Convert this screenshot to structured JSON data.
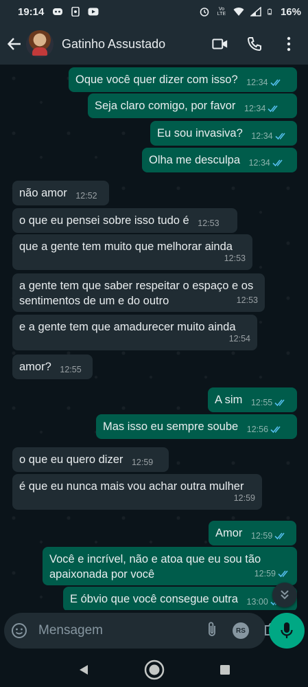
{
  "status": {
    "time": "19:14",
    "battery": "16%",
    "lte": "Vo LTE"
  },
  "header": {
    "contact_name": "Gatinho Assustado"
  },
  "colors": {
    "outgoing": "#005c4b",
    "incoming": "#202c33",
    "accent": "#00a884",
    "tick_read": "#53bdeb"
  },
  "messages": [
    {
      "dir": "out",
      "text": "Oque você quer dizer com isso?",
      "time": "12:34",
      "read": true
    },
    {
      "dir": "out",
      "text": "Seja claro comigo, por favor",
      "time": "12:34",
      "read": true
    },
    {
      "dir": "out",
      "text": "Eu sou invasiva?",
      "time": "12:34",
      "read": true
    },
    {
      "dir": "out",
      "text": "Olha me desculpa",
      "time": "12:34",
      "read": true
    },
    {
      "dir": "in",
      "text": "não amor",
      "time": "12:52"
    },
    {
      "dir": "in",
      "text": "o que eu pensei sobre isso tudo é",
      "time": "12:53"
    },
    {
      "dir": "in",
      "text": "que a gente tem muito que melhorar ainda",
      "time": "12:53"
    },
    {
      "dir": "in",
      "text": "a gente tem que saber respeitar o espaço e os sentimentos de um e do outro",
      "time": "12:53"
    },
    {
      "dir": "in",
      "text": "e a gente tem que amadurecer muito ainda",
      "time": "12:54"
    },
    {
      "dir": "in",
      "text": "amor?",
      "time": "12:55"
    },
    {
      "dir": "out",
      "text": "A sim",
      "time": "12:55",
      "read": true
    },
    {
      "dir": "out",
      "text": "Mas isso eu sempre soube",
      "time": "12:56",
      "read": true
    },
    {
      "dir": "in",
      "text": "o que eu quero dizer",
      "time": "12:59"
    },
    {
      "dir": "in",
      "text": "é que eu nunca mais vou achar outra mulher",
      "time": "12:59"
    },
    {
      "dir": "out",
      "text": "Amor",
      "time": "12:59",
      "read": true
    },
    {
      "dir": "out",
      "text": "Você e incrível, não e atoa que eu sou tão apaixonada por você",
      "time": "12:59",
      "read": true
    },
    {
      "dir": "out",
      "text": "E óbvio que você consegue outra",
      "time": "13:00",
      "read": true
    }
  ],
  "composer": {
    "placeholder": "Mensagem",
    "rs_label": "RS"
  },
  "icons": [
    "back-arrow-icon",
    "video-call-icon",
    "phone-icon",
    "more-options-icon",
    "emoji-icon",
    "attach-icon",
    "camera-icon",
    "mic-icon",
    "scroll-down-icon",
    "nav-back-icon",
    "nav-home-icon",
    "nav-recents-icon"
  ]
}
